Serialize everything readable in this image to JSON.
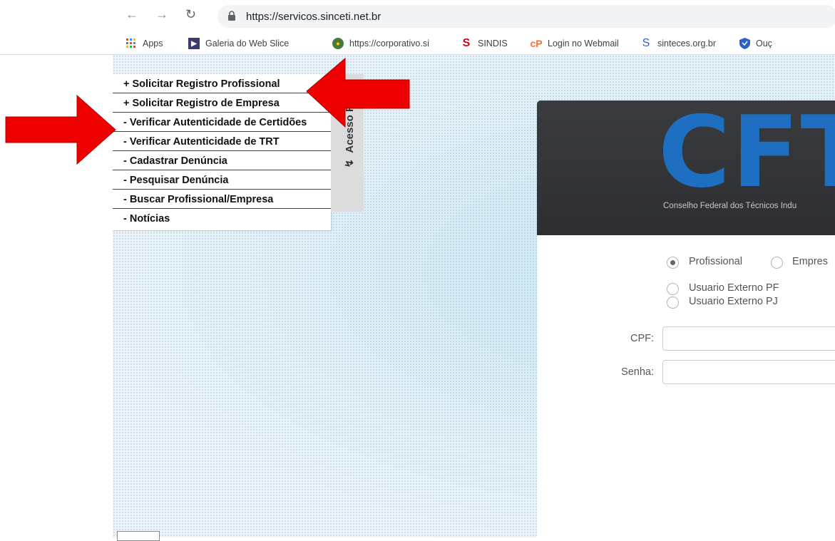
{
  "browser": {
    "url": "https://servicos.sinceti.net.br",
    "bookmarks": [
      {
        "label": "Apps",
        "icon": "apps-grid-icon"
      },
      {
        "label": "Galeria do Web Slice",
        "icon": "web-slice-icon"
      },
      {
        "label": "https://corporativo.si",
        "icon": "globe-icon"
      },
      {
        "label": "SINDIS",
        "icon": "sindis-s-icon"
      },
      {
        "label": "Login no Webmail",
        "icon": "cpanel-icon"
      },
      {
        "label": "sinteces.org.br",
        "icon": "sinteces-s-icon"
      },
      {
        "label": "Ouç",
        "icon": "shield-icon"
      }
    ]
  },
  "menu": {
    "items": [
      "+ Solicitar Registro Profissional",
      "+ Solicitar Registro de Empresa",
      "- Verificar Autenticidade de Certidões",
      "- Verificar Autenticidade de TRT",
      "- Cadastrar Denúncia",
      "- Pesquisar Denúncia",
      "- Buscar Profissional/Empresa",
      "- Notícias"
    ],
    "tab_label": "Acesso Rápi"
  },
  "login": {
    "logo_text": "CFT",
    "logo_subtitle": "Conselho Federal dos Técnicos Indu",
    "radio_type": [
      {
        "label": "Profissional",
        "selected": true
      },
      {
        "label": "Empres",
        "selected": false
      }
    ],
    "radio_user": [
      {
        "label": "Usuario Externo PF",
        "selected": false
      },
      {
        "label": "Usuario Externo PJ",
        "selected": false
      }
    ],
    "cpf_label": "CPF:",
    "cpf_value": "",
    "senha_label": "Senha:",
    "senha_value": ""
  },
  "colors": {
    "arrow": "#ee0000",
    "logo_blue": "#1e6fc2",
    "card_dark": "#333438"
  }
}
